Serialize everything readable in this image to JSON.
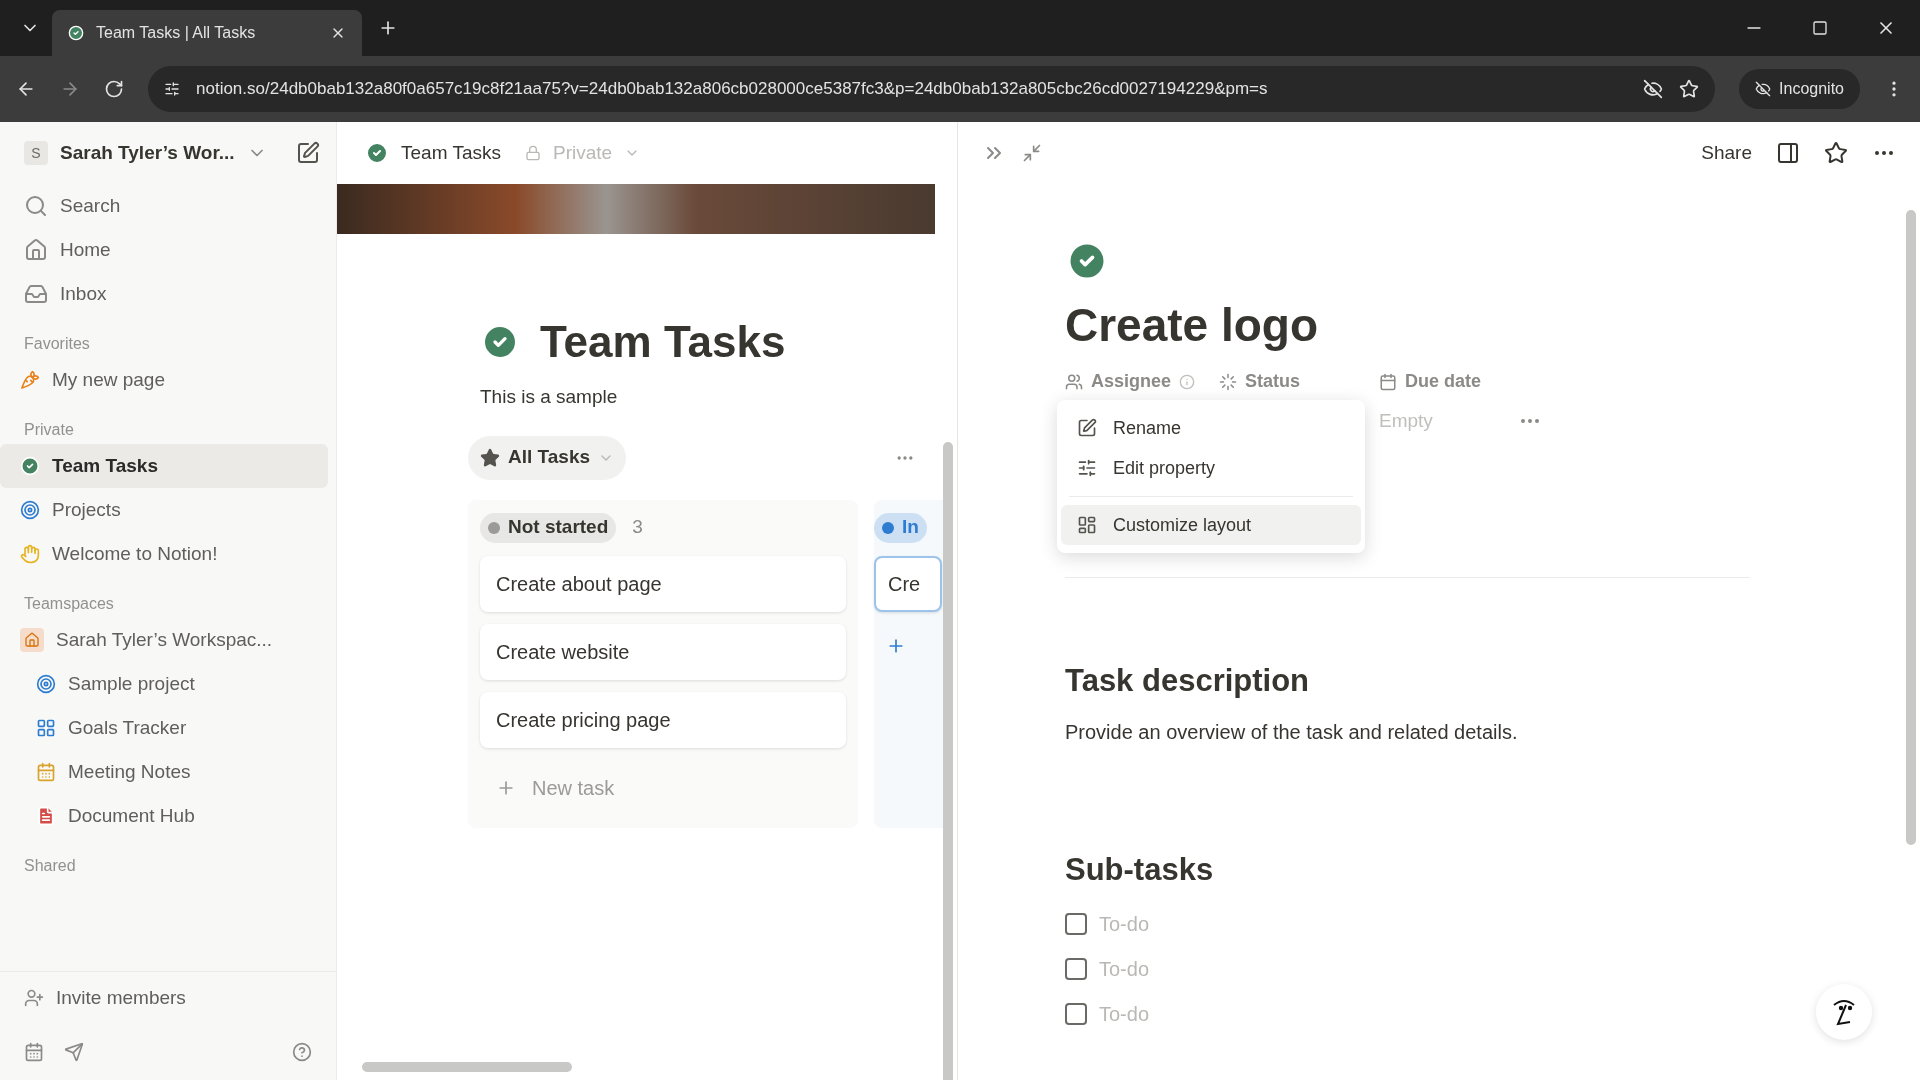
{
  "browser": {
    "tab_title": "Team Tasks | All Tasks",
    "url": "notion.so/24db0bab132a80f0a657c19c8f21aa75?v=24db0bab132a806cb028000ce5387fc3&p=24db0bab132a805cbc26cd0027194229&pm=s",
    "profile": "Incognito"
  },
  "sidebar": {
    "workspace_initial": "S",
    "workspace": "Sarah Tyler’s Wor...",
    "nav": [
      {
        "label": "Search",
        "kind": "search"
      },
      {
        "label": "Home",
        "kind": "home"
      },
      {
        "label": "Inbox",
        "kind": "inbox"
      }
    ],
    "sections": [
      {
        "title": "Favorites",
        "items": [
          {
            "label": "My new page",
            "kind": "carrot",
            "selected": false
          }
        ]
      },
      {
        "title": "Private",
        "items": [
          {
            "label": "Team Tasks",
            "kind": "check",
            "selected": true
          },
          {
            "label": "Projects",
            "kind": "target",
            "selected": false
          },
          {
            "label": "Welcome to Notion!",
            "kind": "wave",
            "selected": false
          }
        ]
      },
      {
        "title": "Teamspaces",
        "items": [
          {
            "label": "Sarah Tyler’s Workspac...",
            "kind": "house",
            "selected": false,
            "children": [
              {
                "label": "Sample project",
                "kind": "target",
                "selected": false
              },
              {
                "label": "Goals Tracker",
                "kind": "goals",
                "selected": false
              },
              {
                "label": "Meeting Notes",
                "kind": "calendar",
                "selected": false
              },
              {
                "label": "Document Hub",
                "kind": "document",
                "selected": false
              }
            ]
          }
        ]
      },
      {
        "title": "Shared"
      }
    ],
    "invite": "Invite members"
  },
  "board": {
    "breadcrumb": "Team Tasks",
    "privacy": "Private",
    "title": "Team Tasks",
    "description": "This is a sample",
    "view": "All Tasks",
    "columns": [
      {
        "status": "Not started",
        "color": "#9b9a97",
        "count": "3",
        "cards": [
          "Create about page",
          "Create website",
          "Create pricing page"
        ],
        "new_label": "New task"
      },
      {
        "status": "In",
        "color": "#2e7cd1",
        "cards": [
          "Cre"
        ]
      }
    ]
  },
  "detail": {
    "share": "Share",
    "title": "Create logo",
    "properties": [
      {
        "label": "Assignee",
        "kind": "people"
      },
      {
        "label": "Status",
        "kind": "status"
      },
      {
        "label": "Due date",
        "kind": "date"
      }
    ],
    "due_value": "Empty",
    "menu": [
      {
        "label": "Rename",
        "kind": "rename",
        "selected": false
      },
      {
        "label": "Edit property",
        "kind": "sliders",
        "selected": false
      },
      {
        "label": "Customize layout",
        "kind": "layout",
        "selected": true
      }
    ],
    "description_heading": "Task description",
    "description": "Provide an overview of the task and related details.",
    "subtasks_heading": "Sub-tasks",
    "todos": [
      {
        "label": "To-do",
        "checked": false
      },
      {
        "label": "To-do",
        "checked": false
      },
      {
        "label": "To-do",
        "checked": false
      }
    ]
  }
}
